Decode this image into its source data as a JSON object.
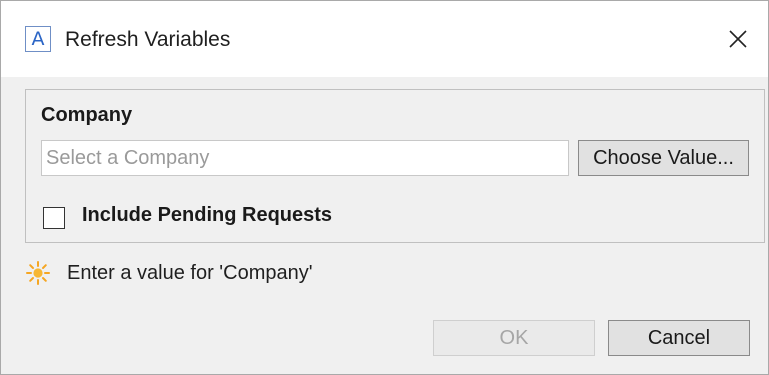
{
  "window": {
    "title": "Refresh Variables",
    "app_icon_letter": "A",
    "close_icon": "close-icon"
  },
  "group": {
    "label": "Company",
    "input_value": "",
    "input_placeholder": "Select a Company",
    "choose_button_label": "Choose Value...",
    "checkbox_label": "Include Pending Requests",
    "checkbox_checked": false
  },
  "validation": {
    "icon": "sun-warning-icon",
    "message": "Enter a value for 'Company'",
    "icon_color": "#f5a623"
  },
  "footer": {
    "ok_label": "OK",
    "ok_enabled": false,
    "cancel_label": "Cancel"
  }
}
